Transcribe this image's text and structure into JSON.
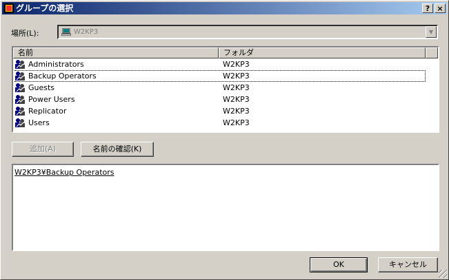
{
  "window": {
    "title": "グループの選択",
    "help_button": "?",
    "close_button": "×"
  },
  "location": {
    "label": "場所(L):",
    "value": "W2KP3"
  },
  "list": {
    "columns": [
      "名前",
      "フォルダ"
    ],
    "rows": [
      {
        "name": "Administrators",
        "folder": "W2KP3"
      },
      {
        "name": "Backup Operators",
        "folder": "W2KP3"
      },
      {
        "name": "Guests",
        "folder": "W2KP3"
      },
      {
        "name": "Power Users",
        "folder": "W2KP3"
      },
      {
        "name": "Replicator",
        "folder": "W2KP3"
      },
      {
        "name": "Users",
        "folder": "W2KP3"
      }
    ],
    "focused_row": "Backup Operators"
  },
  "buttons": {
    "add": "追加(A)",
    "check_names": "名前の確認(K)",
    "ok": "OK",
    "cancel": "キャンセル"
  },
  "selection": {
    "text": "W2KP3¥Backup Operators"
  }
}
